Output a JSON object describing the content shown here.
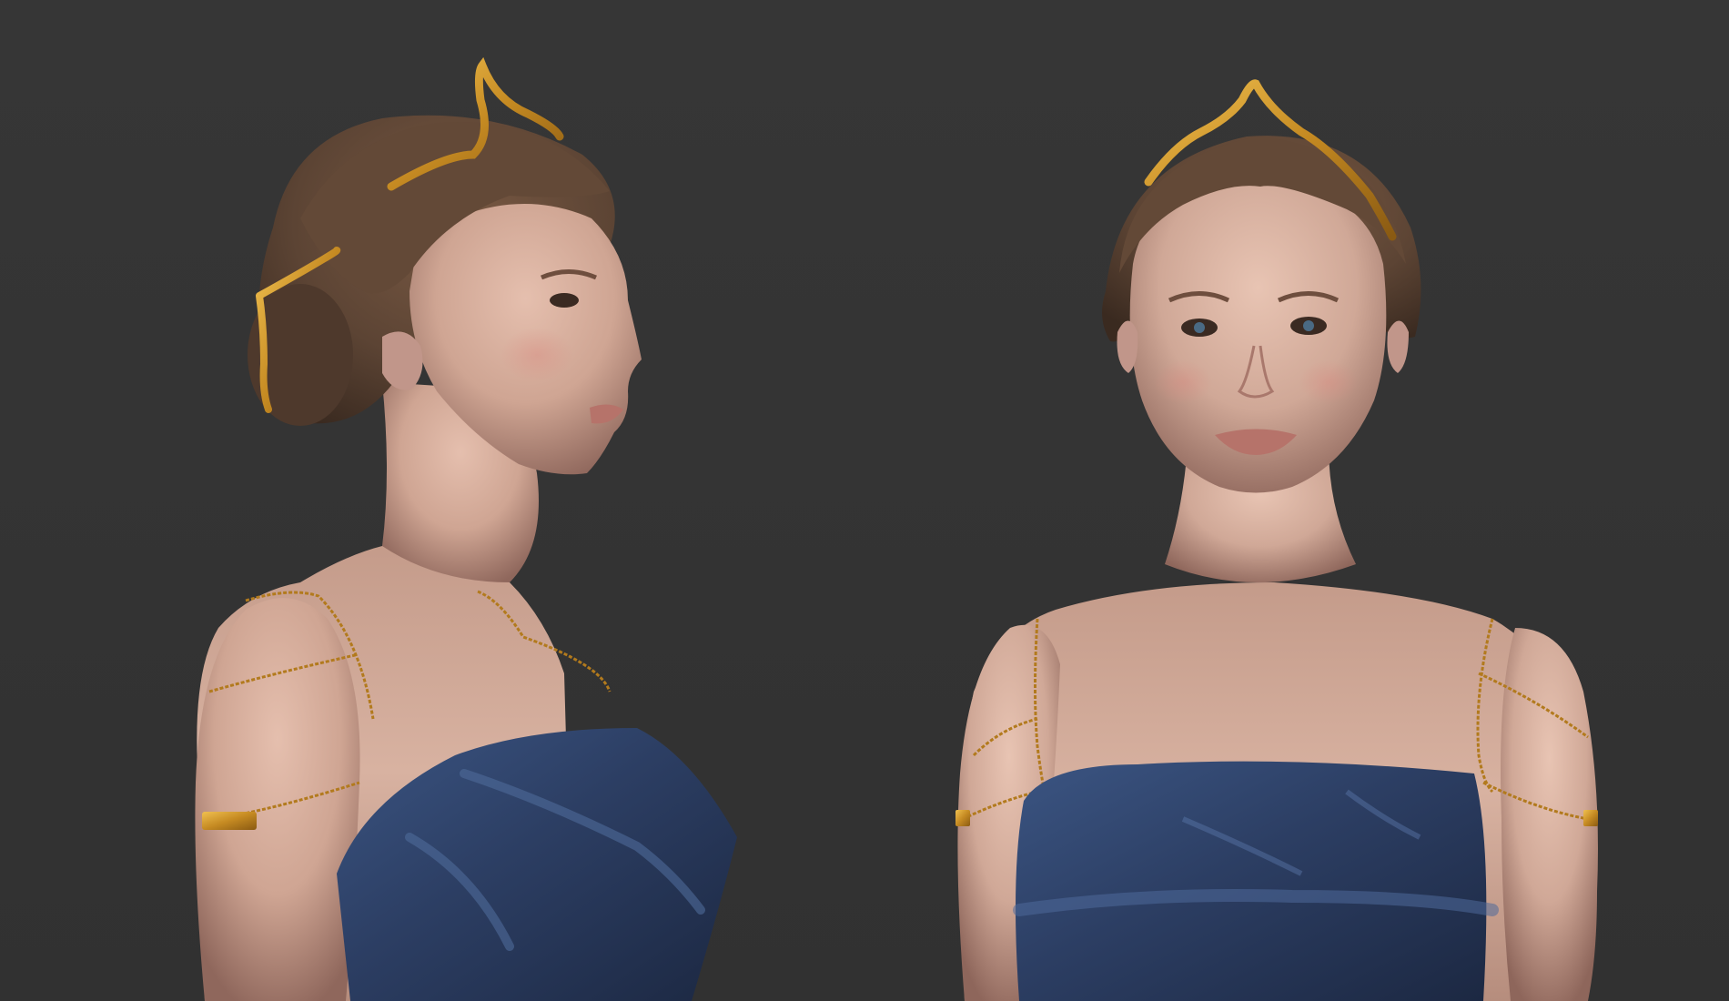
{
  "scene": {
    "background_color": "#353535",
    "views": [
      {
        "view": "three-quarter-profile"
      },
      {
        "view": "front"
      }
    ],
    "colors": {
      "skin": "#cfa593",
      "skin_shadow": "#8f675c",
      "hair": "#5c4434",
      "hair_dark": "#3f2e24",
      "gold": "#c58a22",
      "dress": "#2c3e63",
      "dress_highlight": "#4e6a9a"
    }
  }
}
